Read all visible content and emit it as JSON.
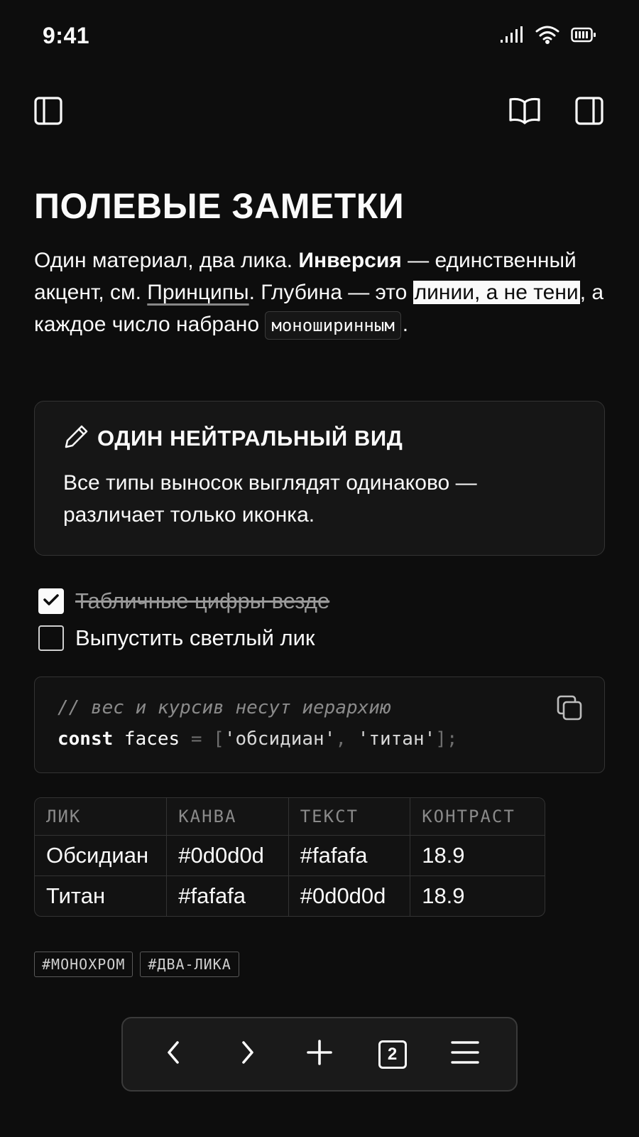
{
  "status": {
    "time": "9:41"
  },
  "icons": {
    "sidebar_left": "sidebar-left-icon",
    "reading_mode": "book-open-icon",
    "sidebar_right": "sidebar-right-icon",
    "callout": "pencil-icon",
    "copy": "copy-icon",
    "back": "chevron-left-icon",
    "forward": "chevron-right-icon",
    "new_tab": "plus-icon",
    "menu": "menu-icon"
  },
  "note": {
    "title": "ПОЛЕВЫЕ ЗАМЕТКИ",
    "para": {
      "t1": "Один материал, два лика. ",
      "bold": "Инверсия",
      "t2": " — единственный акцент, см. ",
      "link": "Принципы",
      "t3": ". Глубина — это ",
      "highlight": "линии, а не тени",
      "t4": ", а каждое число набрано ",
      "code": "моноширинным",
      "t5": "."
    },
    "callout": {
      "title": "ОДИН НЕЙТРАЛЬНЫЙ ВИД",
      "body": "Все типы выносок выглядят одинаково — различает только иконка."
    },
    "tasks": [
      {
        "label": "Табличные цифры везде",
        "done": true
      },
      {
        "label": "Выпустить светлый лик",
        "done": false
      }
    ],
    "code": {
      "comment": "// вес и курсив несут иерархию",
      "keyword": "const",
      "ident": " faces ",
      "eq": "= ",
      "open": "[",
      "str1": "'обсидиан'",
      "comma": ", ",
      "str2": "'титан'",
      "close": "];"
    },
    "table": {
      "headers": [
        "ЛИК",
        "КАНВА",
        "ТЕКСТ",
        "КОНТРАСТ"
      ],
      "rows": [
        [
          "Обсидиан",
          "#0d0d0d",
          "#fafafa",
          "18.9"
        ],
        [
          "Титан",
          "#fafafa",
          "#0d0d0d",
          "18.9"
        ]
      ]
    },
    "tags": [
      "#МОНОХРОМ",
      "#ДВА-ЛИКА"
    ]
  },
  "bottom_bar": {
    "tab_count": "2"
  },
  "colors": {
    "background": "#0d0d0d",
    "text": "#fafafa",
    "border": "#333333",
    "muted": "#8a8a8a"
  }
}
